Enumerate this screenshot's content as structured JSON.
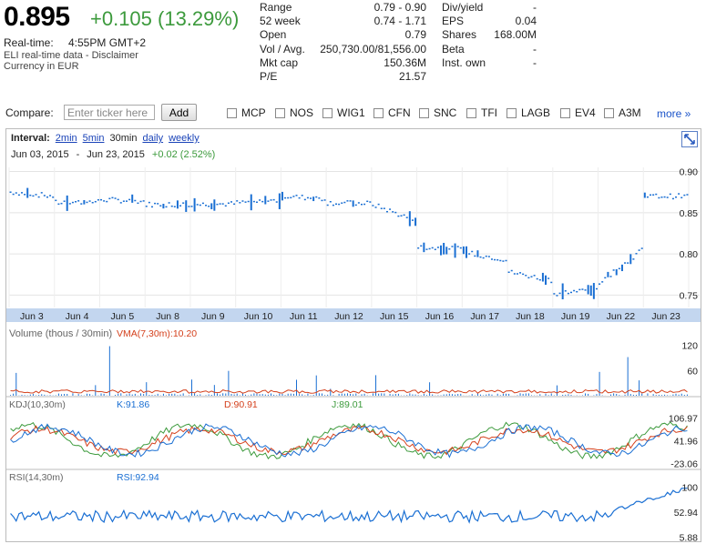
{
  "quote": {
    "price": "0.895",
    "change": "+0.105 (13.29%)",
    "realtime_label": "Real-time:",
    "realtime_time": "4:55PM GMT+2",
    "disclaimer": "ELI real-time data - Disclaimer",
    "currency": "Currency in EUR"
  },
  "stats_left": [
    {
      "label": "Range",
      "value": "0.79 - 0.90"
    },
    {
      "label": "52 week",
      "value": "0.74 - 1.71"
    },
    {
      "label": "Open",
      "value": "0.79"
    },
    {
      "label": "Vol / Avg.",
      "value": "250,730.00/81,556.00"
    },
    {
      "label": "Mkt cap",
      "value": "150.36M"
    },
    {
      "label": "P/E",
      "value": "21.57"
    }
  ],
  "stats_right": [
    {
      "label": "Div/yield",
      "value": "-"
    },
    {
      "label": "EPS",
      "value": "0.04"
    },
    {
      "label": "Shares",
      "value": "168.00M"
    },
    {
      "label": "Beta",
      "value": "-"
    },
    {
      "label": "Inst. own",
      "value": "-"
    }
  ],
  "compare": {
    "label": "Compare:",
    "placeholder": "Enter ticker here",
    "add_label": "Add",
    "tickers": [
      "MCP",
      "NOS",
      "WIG1",
      "CFN",
      "SNC",
      "TFI",
      "LAGB",
      "EV4",
      "A3M"
    ],
    "more_label": "more »"
  },
  "chart": {
    "interval_label": "Interval:",
    "intervals": [
      "2min",
      "5min",
      "30min",
      "daily",
      "weekly"
    ],
    "active_interval": "30min",
    "date_from": "Jun 03, 2015",
    "date_sep": "-",
    "date_to": "Jun 23, 2015",
    "range_change": "+0.02 (2.52%)",
    "volume_label": "Volume (thous / 30min)",
    "vma_label": "VMA(7,30m):10.20",
    "kdj_label": "KDJ(10,30m)",
    "k_label": "K:91.86",
    "d_label": "D:90.91",
    "j_label": "J:89.01",
    "rsi_label": "RSI(14,30m)",
    "rsi_value": "RSI:92.94",
    "colors": {
      "blue": "#1a6fd3",
      "red": "#d4401c",
      "green": "#3c9a3c",
      "axis_band": "#c3d6ef"
    }
  },
  "chart_data": {
    "type": "line",
    "title": "",
    "x": [
      "Jun 3",
      "Jun 4",
      "Jun 5",
      "Jun 8",
      "Jun 9",
      "Jun 10",
      "Jun 11",
      "Jun 12",
      "Jun 15",
      "Jun 16",
      "Jun 17",
      "Jun 18",
      "Jun 19",
      "Jun 22",
      "Jun 23"
    ],
    "price_axis_ticks": [
      "0.90",
      "0.85",
      "0.80",
      "0.75"
    ],
    "ylim": [
      0.735,
      0.905
    ],
    "series": [
      {
        "name": "",
        "values": [
          0.875,
          0.862,
          0.866,
          0.86,
          0.86,
          0.862,
          0.87,
          0.862,
          0.86,
          0.808,
          0.802,
          0.778,
          0.752,
          0.765,
          0.87
        ]
      }
    ],
    "volume_ticks": [
      "120",
      "60"
    ],
    "kdj_ticks": [
      "106.97",
      "41.96",
      "-23.06"
    ],
    "rsi_ticks": [
      "100",
      "52.94",
      "5.88"
    ]
  }
}
